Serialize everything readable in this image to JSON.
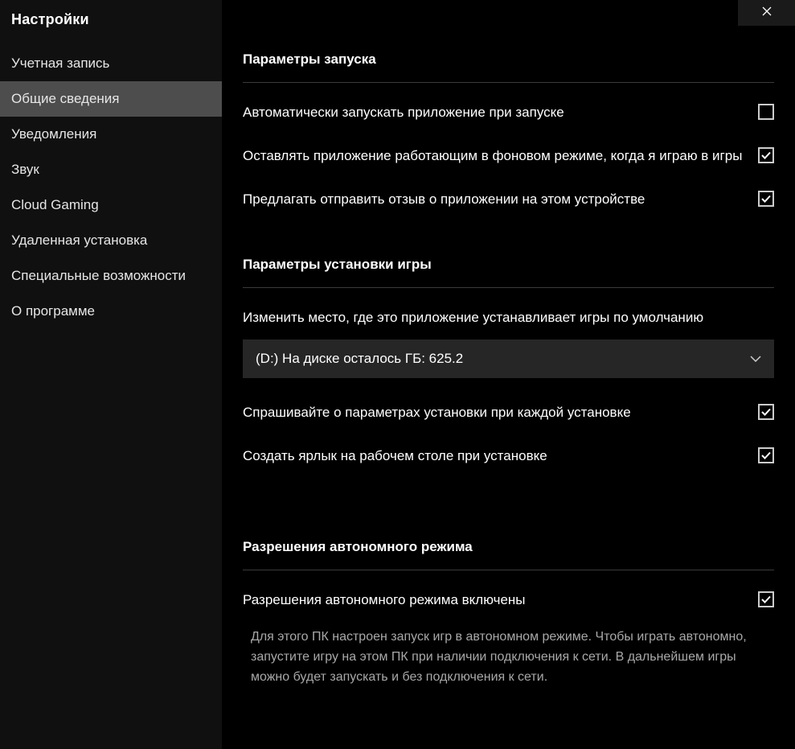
{
  "sidebar": {
    "title": "Настройки",
    "items": [
      {
        "label": "Учетная запись",
        "active": false
      },
      {
        "label": "Общие сведения",
        "active": true
      },
      {
        "label": "Уведомления",
        "active": false
      },
      {
        "label": "Звук",
        "active": false
      },
      {
        "label": "Cloud Gaming",
        "active": false
      },
      {
        "label": "Удаленная установка",
        "active": false
      },
      {
        "label": "Специальные возможности",
        "active": false
      },
      {
        "label": "О программе",
        "active": false
      }
    ]
  },
  "sections": {
    "startup": {
      "title": "Параметры запуска",
      "rows": [
        {
          "label": "Автоматически запускать приложение при запуске",
          "checked": false
        },
        {
          "label": "Оставлять приложение работающим в фоновом режиме, когда я играю в игры",
          "checked": true
        },
        {
          "label": "Предлагать отправить отзыв о приложении на этом устройстве",
          "checked": true
        }
      ]
    },
    "install": {
      "title": "Параметры установки игры",
      "location_label": "Изменить место, где это приложение устанавливает игры по умолчанию",
      "dropdown_value": "(D:) На диске осталось ГБ: 625.2",
      "rows": [
        {
          "label": "Спрашивайте о параметрах установки при каждой установке",
          "checked": true
        },
        {
          "label": "Создать ярлык на рабочем столе при установке",
          "checked": true
        }
      ]
    },
    "offline": {
      "title": "Разрешения автономного режима",
      "row": {
        "label": "Разрешения автономного режима включены",
        "checked": true
      },
      "desc": "Для этого ПК настроен запуск игр в автономном режиме. Чтобы играть автономно, запустите игру на этом ПК при наличии подключения к сети. В дальнейшем игры можно будет запускать и без подключения к сети."
    }
  }
}
